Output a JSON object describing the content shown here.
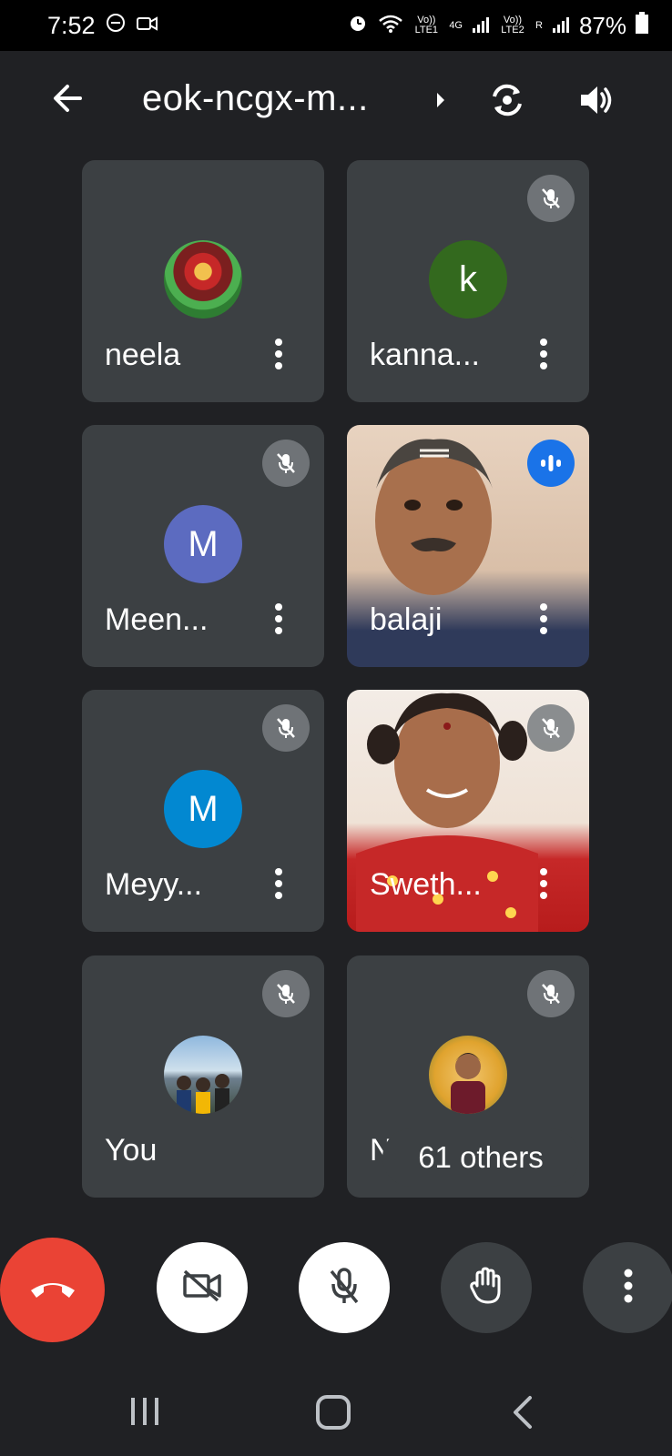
{
  "status_bar": {
    "time": "7:52",
    "battery": "87%",
    "volte1": "Vo)) LTE1",
    "network": "4G",
    "volte2": "Vo)) LTE2",
    "roaming": "R",
    "icons": [
      "do-not-disturb-icon",
      "video-recording-icon",
      "alarm-icon",
      "wifi-icon",
      "signal-icon",
      "battery-icon"
    ]
  },
  "header": {
    "meeting_code": "eok-ncgx-m...",
    "icons": [
      "back-arrow-icon",
      "caret-right-icon",
      "switch-camera-icon",
      "speaker-icon"
    ]
  },
  "participants": [
    {
      "name": "neela",
      "avatar_type": "photo",
      "muted": false,
      "speaking": false
    },
    {
      "name": "kanna...",
      "avatar_type": "letter",
      "letter": "k",
      "avatar_color": "#33691e",
      "muted": true,
      "speaking": false
    },
    {
      "name": "Meen...",
      "avatar_type": "letter",
      "letter": "M",
      "avatar_color": "#5c6bc0",
      "muted": true,
      "speaking": false
    },
    {
      "name": "balaji",
      "avatar_type": "video",
      "muted": false,
      "speaking": true
    },
    {
      "name": "Meyy...",
      "avatar_type": "letter",
      "letter": "M",
      "avatar_color": "#0288d1",
      "muted": true,
      "speaking": false
    },
    {
      "name": "Sweth...",
      "avatar_type": "video",
      "muted": true,
      "speaking": false
    },
    {
      "name": "You",
      "avatar_type": "photo",
      "muted": true,
      "speaking": false
    },
    {
      "name": "Nithin",
      "avatar_type": "photo",
      "muted": true,
      "speaking": false
    }
  ],
  "others_pill": "61 others",
  "controls": {
    "icons": [
      "end-call-icon",
      "camera-off-icon",
      "mic-off-icon",
      "raise-hand-icon",
      "more-options-icon"
    ],
    "end_call_color": "#ea4335"
  },
  "nav": {
    "icons": [
      "recent-apps-icon",
      "home-icon",
      "back-icon"
    ]
  }
}
